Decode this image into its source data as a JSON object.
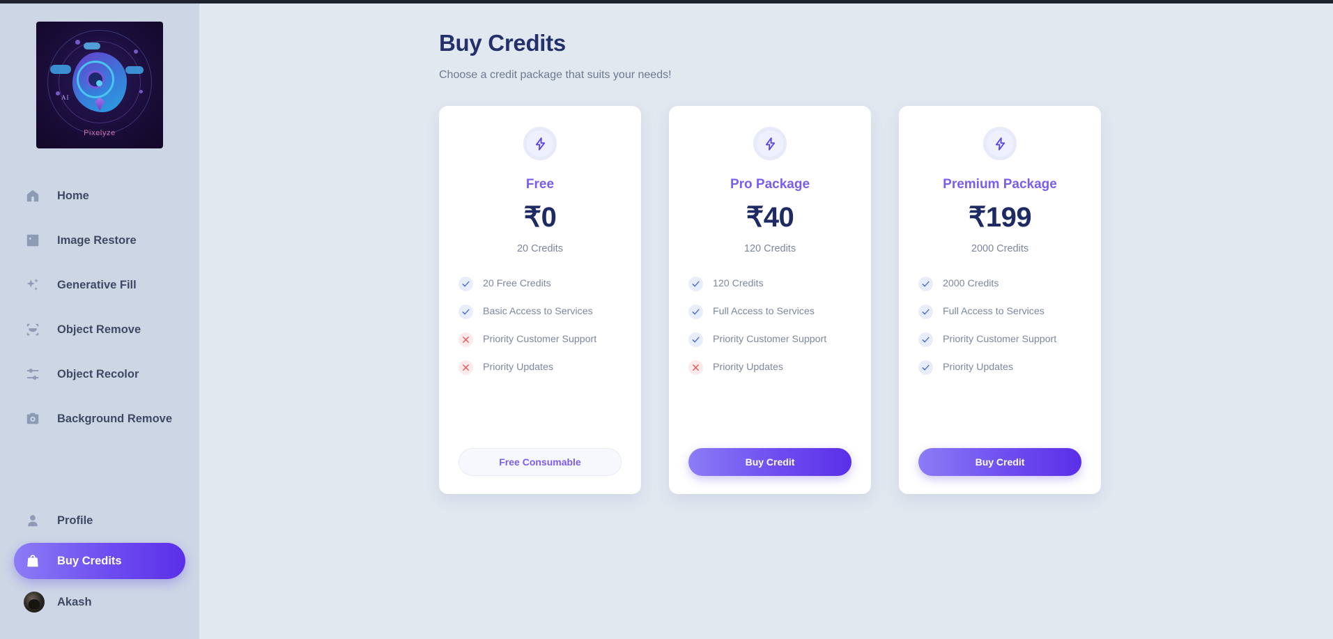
{
  "sidebar": {
    "logo": {
      "brand_text": "Pixelyze",
      "ai_label": "AI",
      "icon": "ai-brain-logo"
    },
    "items": [
      {
        "label": "Home",
        "icon": "home-icon"
      },
      {
        "label": "Image Restore",
        "icon": "image-icon"
      },
      {
        "label": "Generative Fill",
        "icon": "sparkles-icon"
      },
      {
        "label": "Object Remove",
        "icon": "scan-object-icon"
      },
      {
        "label": "Object Recolor",
        "icon": "sliders-icon"
      },
      {
        "label": "Background Remove",
        "icon": "camera-icon"
      }
    ],
    "bottom_items": [
      {
        "label": "Profile",
        "icon": "user-icon",
        "active": false
      },
      {
        "label": "Buy Credits",
        "icon": "shopping-bag-icon",
        "active": true
      }
    ],
    "user": {
      "name": "Akash",
      "avatar": "user-avatar"
    }
  },
  "main": {
    "title": "Buy Credits",
    "subtitle": "Choose a credit package that suits your needs!",
    "plans": [
      {
        "icon": "lightning-bolt-icon",
        "name": "Free",
        "price": "₹0",
        "credits": "20 Credits",
        "features": [
          {
            "text": "20 Free Credits",
            "included": true
          },
          {
            "text": "Basic Access to Services",
            "included": true
          },
          {
            "text": "Priority Customer Support",
            "included": false
          },
          {
            "text": "Priority Updates",
            "included": false
          }
        ],
        "cta_label": "Free Consumable",
        "cta_style": "outline"
      },
      {
        "icon": "lightning-bolt-icon",
        "name": "Pro Package",
        "price": "₹40",
        "credits": "120 Credits",
        "features": [
          {
            "text": "120 Credits",
            "included": true
          },
          {
            "text": "Full Access to Services",
            "included": true
          },
          {
            "text": "Priority Customer Support",
            "included": true
          },
          {
            "text": "Priority Updates",
            "included": false
          }
        ],
        "cta_label": "Buy Credit",
        "cta_style": "filled"
      },
      {
        "icon": "lightning-bolt-icon",
        "name": "Premium Package",
        "price": "₹199",
        "credits": "2000 Credits",
        "features": [
          {
            "text": "2000 Credits",
            "included": true
          },
          {
            "text": "Full Access to Services",
            "included": true
          },
          {
            "text": "Priority Customer Support",
            "included": true
          },
          {
            "text": "Priority Updates",
            "included": true
          }
        ],
        "cta_label": "Buy Credit",
        "cta_style": "filled"
      }
    ]
  },
  "colors": {
    "accent": "#6d4df0",
    "plan_name": "#7a5cf0",
    "price": "#1e2a63",
    "check": "#3a62d8",
    "cross": "#e84747",
    "sidebar_bg": "#ccd6e5",
    "page_bg": "#e2e8f0"
  }
}
